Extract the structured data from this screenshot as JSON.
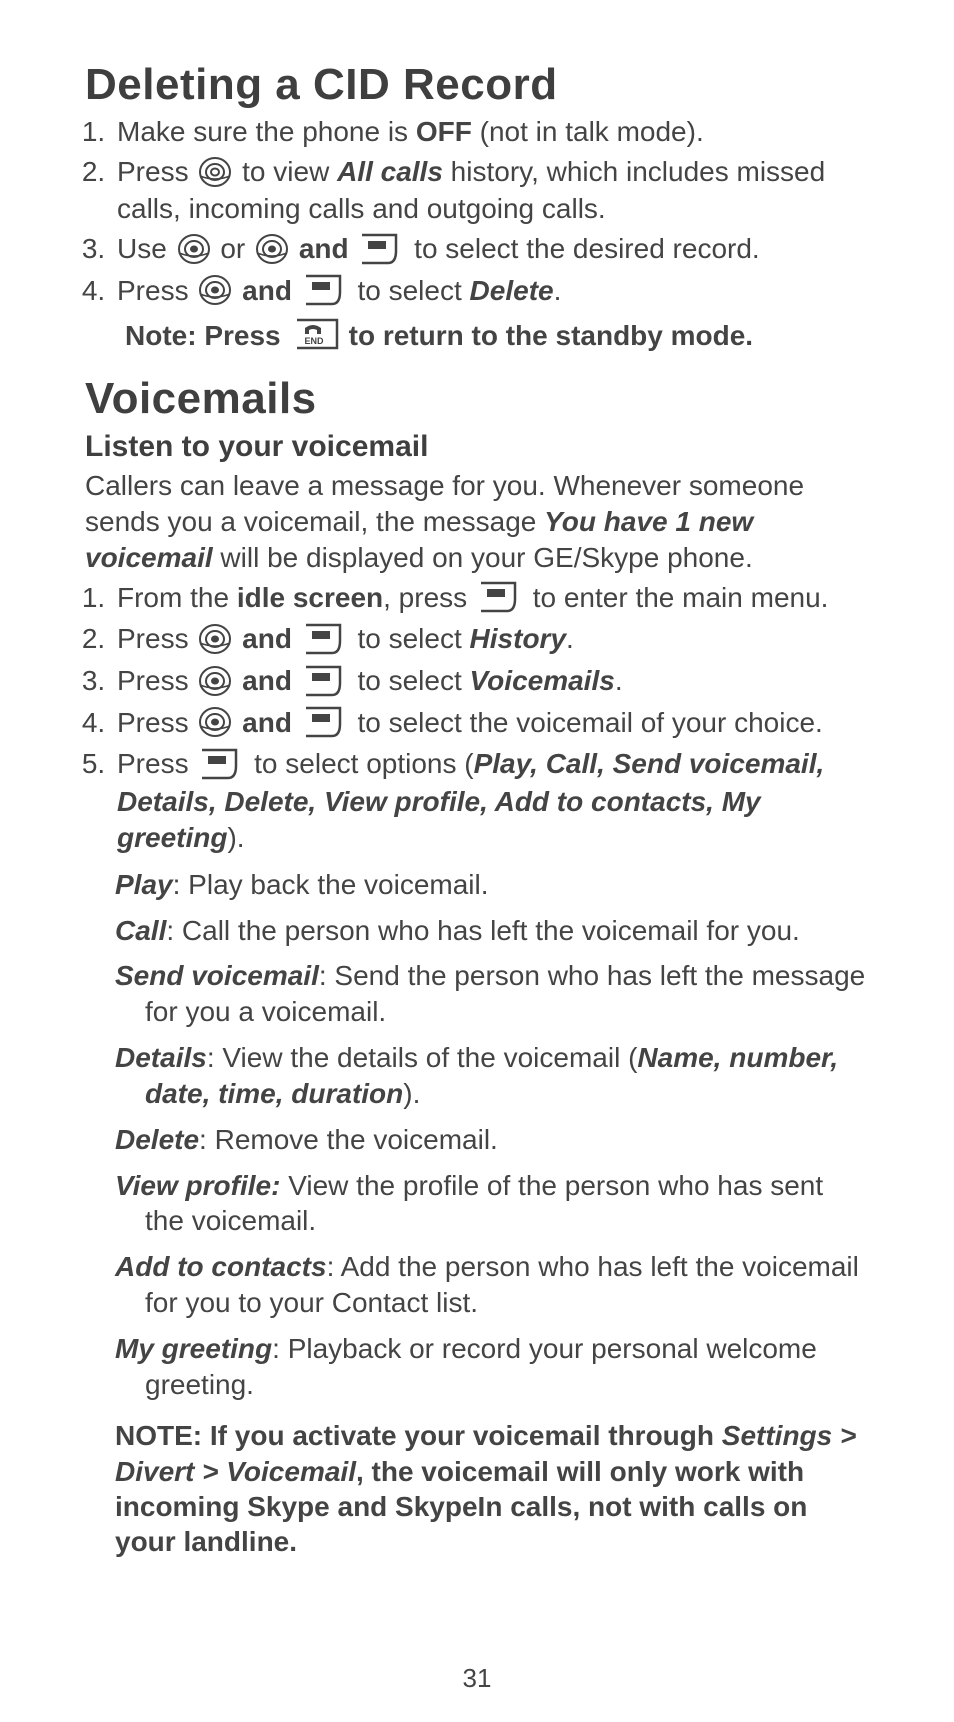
{
  "section1": {
    "title": "Deleting a CID Record",
    "steps": [
      {
        "pre": "Make sure the phone is ",
        "off": "OFF",
        "post": " (not in talk mode)."
      },
      {
        "pre": "Press ",
        "mid1": " to view ",
        "allcalls": "All calls",
        "mid2": " history, which includes missed calls, incoming calls and outgoing calls."
      },
      {
        "pre": "Use ",
        "or": " or ",
        "and": " and  ",
        "post": " to select the desired record."
      },
      {
        "pre": "Press ",
        "and": " and  ",
        "mid": " to select ",
        "delete": "Delete",
        "post": "."
      }
    ],
    "note_pre": "Note: Press  ",
    "note_post": " to return to the standby mode."
  },
  "section2": {
    "title": "Voicemails",
    "subtitle": "Listen to your voicemail",
    "intro_pre": "Callers can leave a message for you. Whenever someone sends you a voicemail, the message ",
    "intro_bold": "You have 1 new voicemail",
    "intro_post": " will be displayed on your GE/Skype phone.",
    "steps": [
      {
        "pre": "From the ",
        "idle": "idle screen",
        "mid": ", press  ",
        "post": " to enter the main menu."
      },
      {
        "pre": "Press ",
        "and": " and  ",
        "mid": " to select ",
        "target": "History",
        "post": "."
      },
      {
        "pre": "Press ",
        "and": " and  ",
        "mid": " to select ",
        "target": "Voicemails",
        "post": "."
      },
      {
        "pre": "Press ",
        "and": " and  ",
        "post": " to select the voicemail of your choice."
      },
      {
        "pre": "Press  ",
        "mid": "  to select options (",
        "opts": "Play, Call, Send voicemail, Details, Delete, View profile, Add to contacts, My greeting",
        "post": ")."
      }
    ],
    "options": [
      {
        "label": "Play",
        "text": ": Play back the voicemail."
      },
      {
        "label": "Call",
        "text": ": Call the person who has left the voicemail for you."
      },
      {
        "label": "Send voicemail",
        "text": ": Send the person who has left the message for you a voicemail."
      },
      {
        "label": "Details",
        "text_pre": ": View the details of the voicemail (",
        "bold": "Name, number, date, time, duration",
        "text_post": ")."
      },
      {
        "label": "Delete",
        "text": ":  Remove the voicemail."
      },
      {
        "label": "View profile:",
        "text": " View the profile of the person who has sent the voicemail."
      },
      {
        "label": "Add to contacts",
        "text": ": Add the person who has left the voicemail for you to your Contact list."
      },
      {
        "label": "My greeting",
        "text": ": Playback or record your personal welcome greeting."
      }
    ],
    "note_pre": "NOTE:  If you activate your voicemail through ",
    "note_path": "Settings > Divert > Voicemail",
    "note_post": ", the voicemail will only work with incoming Skype and SkypeIn calls, not with calls on your landline."
  },
  "page_number": "31"
}
